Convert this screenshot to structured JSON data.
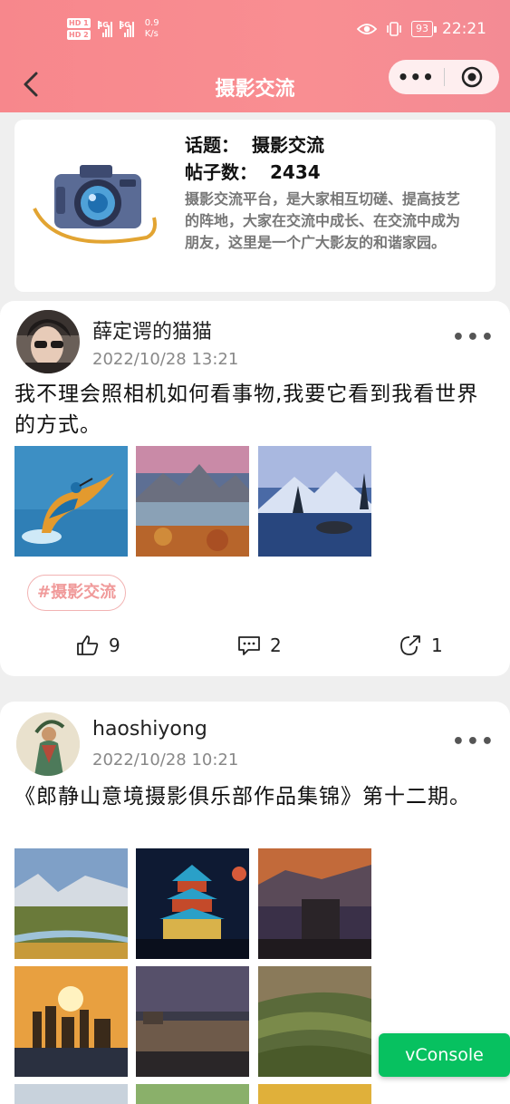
{
  "status_bar": {
    "net_a": "4G",
    "net_b": "5G",
    "speed_value": "0.9",
    "speed_unit": "K/s",
    "battery": "93",
    "time": "22:21"
  },
  "nav": {
    "title": "摄影交流"
  },
  "topic": {
    "label": "话题：",
    "name": "摄影交流",
    "count_label": "帖子数：",
    "count": "2434",
    "description": "摄影交流平台，是大家相互切磋、提高技艺的阵地，大家在交流中成长、在交流中成为朋友，这里是一个广大影友的和谐家园。"
  },
  "posts": [
    {
      "username": "薛定谔的猫猫",
      "time": "2022/10/28 13:21",
      "text": "我不理会照相机如何看事物,我要它看到我看世界的方式。",
      "tag": "#摄影交流",
      "likes": "9",
      "comments": "2",
      "shares": "1"
    },
    {
      "username": "haoshiyong",
      "time": "2022/10/28 10:21",
      "text": "《郎静山意境摄影俱乐部作品集锦》第十二期。"
    }
  ],
  "vconsole": {
    "label": "vConsole"
  },
  "colors": {
    "header_from": "#f7878c",
    "header_to": "#f38b94",
    "tag": "#f09a9a",
    "vconsole": "#07c160"
  }
}
